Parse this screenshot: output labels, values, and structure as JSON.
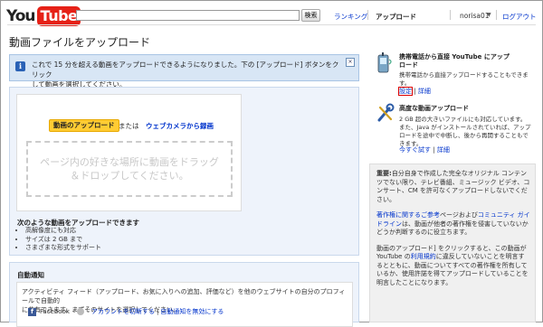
{
  "header": {
    "logo": {
      "you": "You",
      "tube": "Tube"
    },
    "search": {
      "value": "",
      "button": "検索"
    },
    "nav": {
      "ranking": "ランキング",
      "upload": "アップロード"
    },
    "user": "norisa01",
    "logout": "ログアウト"
  },
  "page_title": "動画ファイルをアップロード",
  "notice": {
    "line1": "これで 15 分を超える動画をアップロードできるようになりました。下の [アップロード] ボタンをクリック",
    "line2": "して動画を選択してください。"
  },
  "upload": {
    "button": "動画のアップロード",
    "or": "または",
    "webcam": "ウェブカメラから録画",
    "drop_line1": "ページ内の好きな場所に動画をドラッグ",
    "drop_line2": "＆ドロップしてください。"
  },
  "features": {
    "title": "次のような動画をアップロードできます",
    "items": [
      "高解像度にも対応",
      "サイズは 2 GB まで",
      "さまざまな形式をサポート"
    ]
  },
  "auto_notify": {
    "title": "自動通知",
    "line1": "アクティビティ フィード（アップロード、お気に入りへの追加、評価など）を他のウェブサイトの自分のプロフィールで自動的",
    "line2": "に共有できます。まずそのサイトを選択してください。",
    "facebook": "Facebook",
    "switch_account": "アカウントを切断する",
    "disable": "自動通知を無効にする"
  },
  "sidebar": {
    "mobile": {
      "title_line1": "携帯電話から直接 YouTube にアップ",
      "title_line2": "ロード",
      "desc": "携帯電話から直接アップロードすることもできます。",
      "settings": "設定",
      "details": "詳細"
    },
    "advanced": {
      "title": "高度な動画アップロード",
      "line1": "2 GB 超の大きいファイルにも対応しています。",
      "line2": "また、Java がインストールされていれば、アップ",
      "line3": "ロードを途中で中断し、後から再開することもで",
      "line4": "きます。",
      "try": "今すぐ試す",
      "details": "詳細"
    },
    "notes": {
      "important_label": "重要:",
      "p1": "自分自身で作成した完全なオリジナル コンテンツでない限り、テレビ番組、ミュージック ビデオ、コンサート、CM を許可なくアップロードしないでください。",
      "p2_link1": "著作権に関するご参考",
      "p2_mid": "ページおよび",
      "p2_link2": "コミュニティ ガイドライン",
      "p2_end": "は、動画が他者の著作権を侵害していないかどうか判断するのに役立ちます。",
      "p3_start": "動画のアップロード] をクリックすると、この動画が YouTube の",
      "p3_link": "利用規約",
      "p3_end": "に違反していないことを明言するとともに、動画についてすべての著作権を所有しているか、使用許諾を得てアップロードしていることを明言したことになります。"
    }
  }
}
